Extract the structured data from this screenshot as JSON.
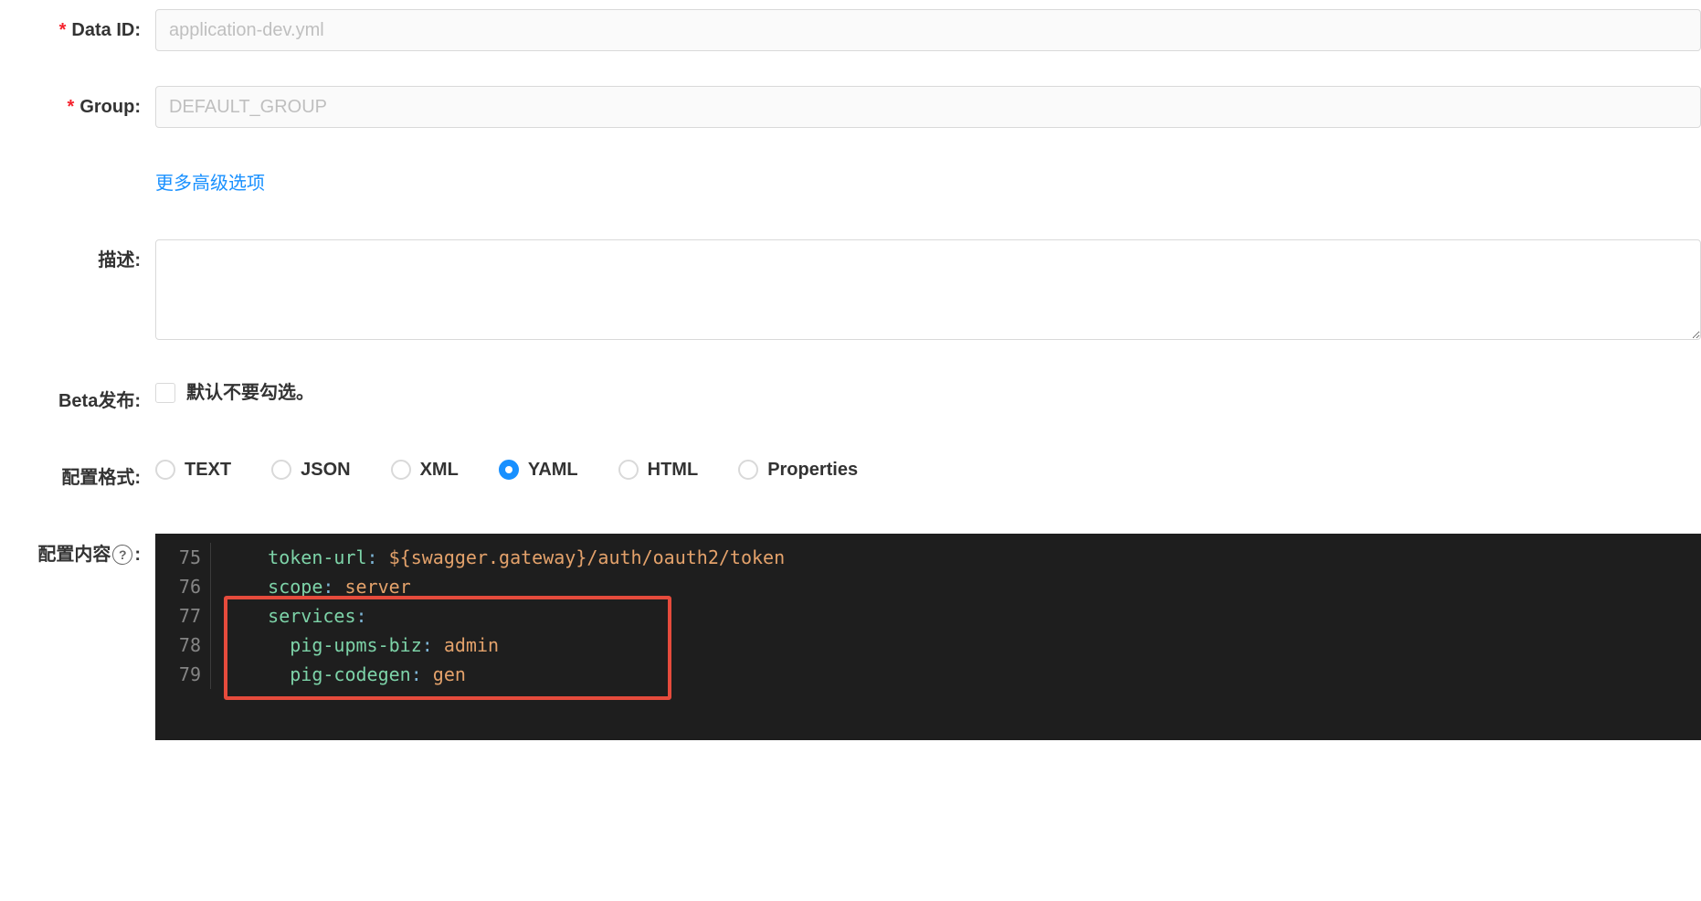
{
  "form": {
    "dataIdLabel": "Data ID:",
    "dataIdPlaceholder": "application-dev.yml",
    "groupLabel": "Group:",
    "groupPlaceholder": "DEFAULT_GROUP",
    "moreOptions": "更多高级选项",
    "descLabel": "描述:",
    "betaLabel": "Beta发布:",
    "betaHint": "默认不要勾选。",
    "formatLabel": "配置格式:",
    "contentLabel": "配置内容",
    "helpGlyph": "?"
  },
  "formats": [
    {
      "label": "TEXT",
      "selected": false
    },
    {
      "label": "JSON",
      "selected": false
    },
    {
      "label": "XML",
      "selected": false
    },
    {
      "label": "YAML",
      "selected": true
    },
    {
      "label": "HTML",
      "selected": false
    },
    {
      "label": "Properties",
      "selected": false
    }
  ],
  "code": {
    "lines": [
      {
        "num": "75",
        "key": "token-url",
        "colon": ": ",
        "value": "${swagger.gateway}/auth/oauth2/token",
        "indent": "    "
      },
      {
        "num": "76",
        "key": "scope",
        "colon": ": ",
        "value": "server",
        "indent": "    "
      },
      {
        "num": "77",
        "key": "services",
        "colon": ":",
        "value": "",
        "indent": "    "
      },
      {
        "num": "78",
        "key": "pig-upms-biz",
        "colon": ": ",
        "value": "admin",
        "indent": "      "
      },
      {
        "num": "79",
        "key": "pig-codegen",
        "colon": ": ",
        "value": "gen",
        "indent": "      "
      }
    ]
  }
}
